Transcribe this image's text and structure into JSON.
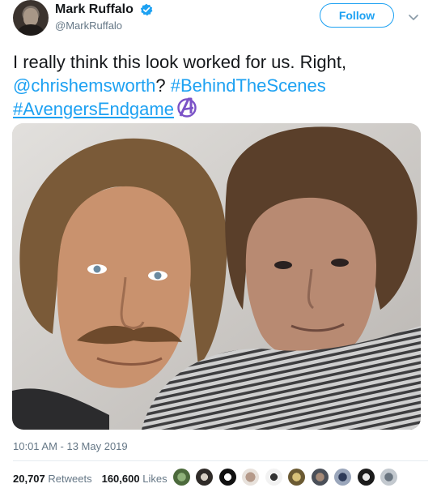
{
  "author": {
    "name": "Mark Ruffalo",
    "handle": "@MarkRuffalo"
  },
  "actions": {
    "follow_label": "Follow"
  },
  "tweet": {
    "text_plain": "I really think this look worked for us. Right, ",
    "mention": "@chrishemsworth",
    "text_after_mention": "? ",
    "hashtag1": "#BehindTheScenes",
    "hashtag2": "#AvengersEndgame"
  },
  "timestamp": "10:01 AM - 13 May 2019",
  "stats": {
    "retweets_count": "20,707",
    "retweets_label": "Retweets",
    "likes_count": "160,600",
    "likes_label": "Likes"
  },
  "colors": {
    "link": "#1da1f2",
    "hashflag": "#7b52c7",
    "muted": "#657786"
  },
  "icons": {
    "verified": "verified-badge-icon",
    "chevron": "chevron-down-icon",
    "hashflag": "avengers-logo-icon"
  }
}
